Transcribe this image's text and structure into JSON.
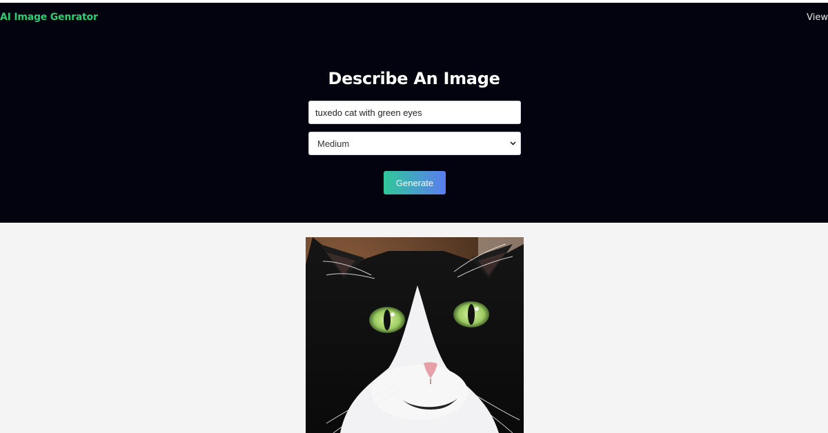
{
  "app": {
    "logo": "AI Image Genrator",
    "nav_link": "View"
  },
  "form": {
    "heading": "Describe An Image",
    "prompt_value": "tuxedo cat with green eyes",
    "size_selected": "Medium",
    "generate_label": "Generate"
  },
  "result": {
    "image_alt": "tuxedo cat with green eyes"
  },
  "colors": {
    "logo": "#2ecc71",
    "hero_bg": "#02030f",
    "page_bg": "#f4f4f4",
    "button_gradient_start": "#30c89a",
    "button_gradient_end": "#5b7cf0"
  }
}
